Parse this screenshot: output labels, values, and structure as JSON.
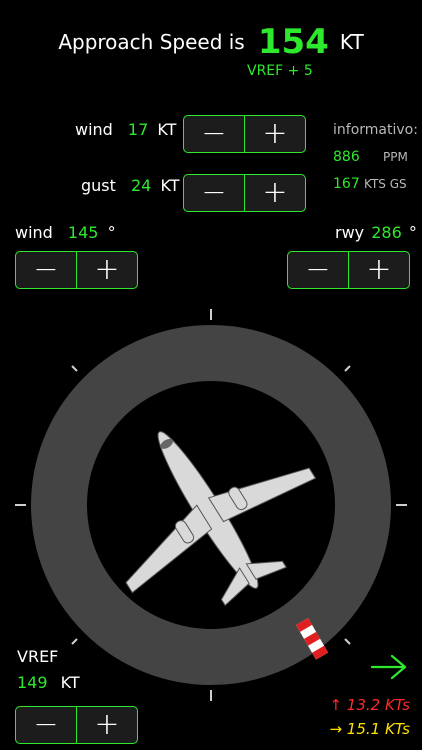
{
  "header": {
    "title_prefix": "Approach Speed is",
    "speed_value": "154",
    "speed_unit": "KT",
    "subtitle": "VREF + 5"
  },
  "wind": {
    "label": "wind",
    "value": "17",
    "unit": "KT"
  },
  "gust": {
    "label": "gust",
    "value": "24",
    "unit": "KT"
  },
  "wind_dir": {
    "label": "wind",
    "value": "145",
    "unit": "°"
  },
  "runway": {
    "label": "rwy",
    "value": "286",
    "unit": "°"
  },
  "info": {
    "title": "informativo:",
    "ppm_value": "886",
    "ppm_unit": "PPM",
    "gs_value": "167",
    "gs_unit": "KTS GS"
  },
  "vref": {
    "label": "VREF",
    "value": "149",
    "unit": "KT"
  },
  "components": {
    "headwind": "↑ 13.2 KTs",
    "crosswind": "→ 15.1 KTs"
  },
  "stepper": {
    "minus": "−",
    "plus": "+"
  },
  "colors": {
    "accent": "#2ee82e",
    "headwind": "#ff2a2a",
    "crosswind": "#ffe100",
    "dial": "#444444"
  }
}
